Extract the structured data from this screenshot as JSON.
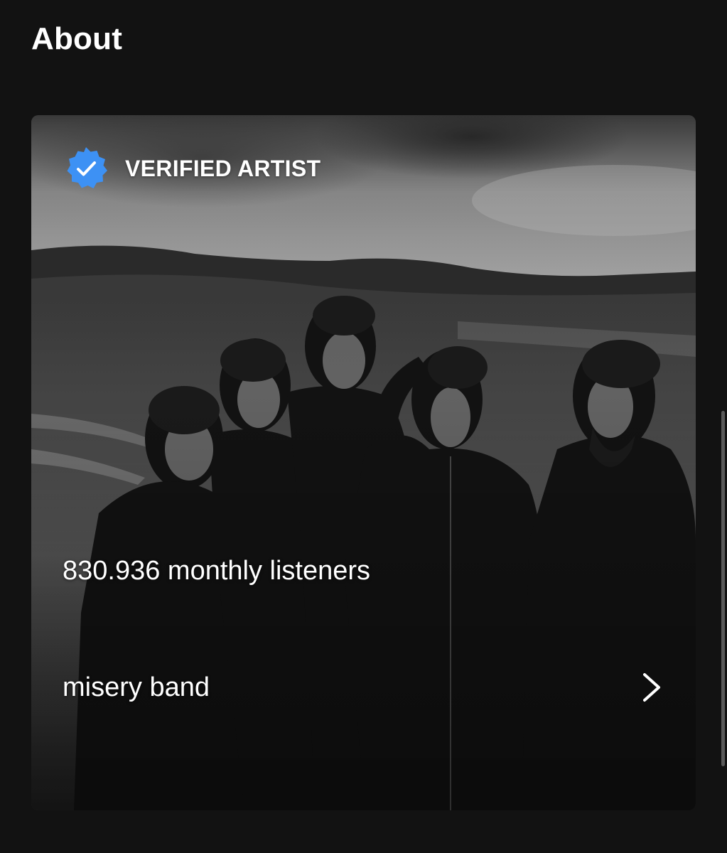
{
  "section": {
    "title": "About"
  },
  "about_card": {
    "verified_label": "VERIFIED ARTIST",
    "monthly_listeners": "830.936 monthly listeners",
    "bio_excerpt": "misery band",
    "photo_description": "black-and-white photo of five band members standing in a moorland landscape",
    "badge_icon": "verified-check-icon",
    "chevron_icon": "chevron-right-icon"
  },
  "colors": {
    "background": "#121212",
    "text": "#ffffff",
    "verified_badge": "#3d91f4"
  }
}
